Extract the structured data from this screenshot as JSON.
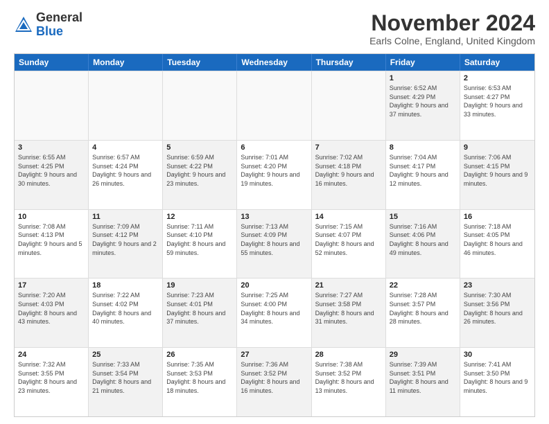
{
  "logo": {
    "general": "General",
    "blue": "Blue"
  },
  "header": {
    "month": "November 2024",
    "location": "Earls Colne, England, United Kingdom"
  },
  "weekdays": [
    "Sunday",
    "Monday",
    "Tuesday",
    "Wednesday",
    "Thursday",
    "Friday",
    "Saturday"
  ],
  "rows": [
    [
      {
        "day": "",
        "empty": true
      },
      {
        "day": "",
        "empty": true
      },
      {
        "day": "",
        "empty": true
      },
      {
        "day": "",
        "empty": true
      },
      {
        "day": "",
        "empty": true
      },
      {
        "day": "1",
        "sunrise": "6:52 AM",
        "sunset": "4:29 PM",
        "daylight": "9 hours and 37 minutes."
      },
      {
        "day": "2",
        "sunrise": "6:53 AM",
        "sunset": "4:27 PM",
        "daylight": "9 hours and 33 minutes."
      }
    ],
    [
      {
        "day": "3",
        "sunrise": "6:55 AM",
        "sunset": "4:25 PM",
        "daylight": "9 hours and 30 minutes."
      },
      {
        "day": "4",
        "sunrise": "6:57 AM",
        "sunset": "4:24 PM",
        "daylight": "9 hours and 26 minutes."
      },
      {
        "day": "5",
        "sunrise": "6:59 AM",
        "sunset": "4:22 PM",
        "daylight": "9 hours and 23 minutes."
      },
      {
        "day": "6",
        "sunrise": "7:01 AM",
        "sunset": "4:20 PM",
        "daylight": "9 hours and 19 minutes."
      },
      {
        "day": "7",
        "sunrise": "7:02 AM",
        "sunset": "4:18 PM",
        "daylight": "9 hours and 16 minutes."
      },
      {
        "day": "8",
        "sunrise": "7:04 AM",
        "sunset": "4:17 PM",
        "daylight": "9 hours and 12 minutes."
      },
      {
        "day": "9",
        "sunrise": "7:06 AM",
        "sunset": "4:15 PM",
        "daylight": "9 hours and 9 minutes."
      }
    ],
    [
      {
        "day": "10",
        "sunrise": "7:08 AM",
        "sunset": "4:13 PM",
        "daylight": "9 hours and 5 minutes."
      },
      {
        "day": "11",
        "sunrise": "7:09 AM",
        "sunset": "4:12 PM",
        "daylight": "9 hours and 2 minutes."
      },
      {
        "day": "12",
        "sunrise": "7:11 AM",
        "sunset": "4:10 PM",
        "daylight": "8 hours and 59 minutes."
      },
      {
        "day": "13",
        "sunrise": "7:13 AM",
        "sunset": "4:09 PM",
        "daylight": "8 hours and 55 minutes."
      },
      {
        "day": "14",
        "sunrise": "7:15 AM",
        "sunset": "4:07 PM",
        "daylight": "8 hours and 52 minutes."
      },
      {
        "day": "15",
        "sunrise": "7:16 AM",
        "sunset": "4:06 PM",
        "daylight": "8 hours and 49 minutes."
      },
      {
        "day": "16",
        "sunrise": "7:18 AM",
        "sunset": "4:05 PM",
        "daylight": "8 hours and 46 minutes."
      }
    ],
    [
      {
        "day": "17",
        "sunrise": "7:20 AM",
        "sunset": "4:03 PM",
        "daylight": "8 hours and 43 minutes."
      },
      {
        "day": "18",
        "sunrise": "7:22 AM",
        "sunset": "4:02 PM",
        "daylight": "8 hours and 40 minutes."
      },
      {
        "day": "19",
        "sunrise": "7:23 AM",
        "sunset": "4:01 PM",
        "daylight": "8 hours and 37 minutes."
      },
      {
        "day": "20",
        "sunrise": "7:25 AM",
        "sunset": "4:00 PM",
        "daylight": "8 hours and 34 minutes."
      },
      {
        "day": "21",
        "sunrise": "7:27 AM",
        "sunset": "3:58 PM",
        "daylight": "8 hours and 31 minutes."
      },
      {
        "day": "22",
        "sunrise": "7:28 AM",
        "sunset": "3:57 PM",
        "daylight": "8 hours and 28 minutes."
      },
      {
        "day": "23",
        "sunrise": "7:30 AM",
        "sunset": "3:56 PM",
        "daylight": "8 hours and 26 minutes."
      }
    ],
    [
      {
        "day": "24",
        "sunrise": "7:32 AM",
        "sunset": "3:55 PM",
        "daylight": "8 hours and 23 minutes."
      },
      {
        "day": "25",
        "sunrise": "7:33 AM",
        "sunset": "3:54 PM",
        "daylight": "8 hours and 21 minutes."
      },
      {
        "day": "26",
        "sunrise": "7:35 AM",
        "sunset": "3:53 PM",
        "daylight": "8 hours and 18 minutes."
      },
      {
        "day": "27",
        "sunrise": "7:36 AM",
        "sunset": "3:52 PM",
        "daylight": "8 hours and 16 minutes."
      },
      {
        "day": "28",
        "sunrise": "7:38 AM",
        "sunset": "3:52 PM",
        "daylight": "8 hours and 13 minutes."
      },
      {
        "day": "29",
        "sunrise": "7:39 AM",
        "sunset": "3:51 PM",
        "daylight": "8 hours and 11 minutes."
      },
      {
        "day": "30",
        "sunrise": "7:41 AM",
        "sunset": "3:50 PM",
        "daylight": "8 hours and 9 minutes."
      }
    ]
  ]
}
